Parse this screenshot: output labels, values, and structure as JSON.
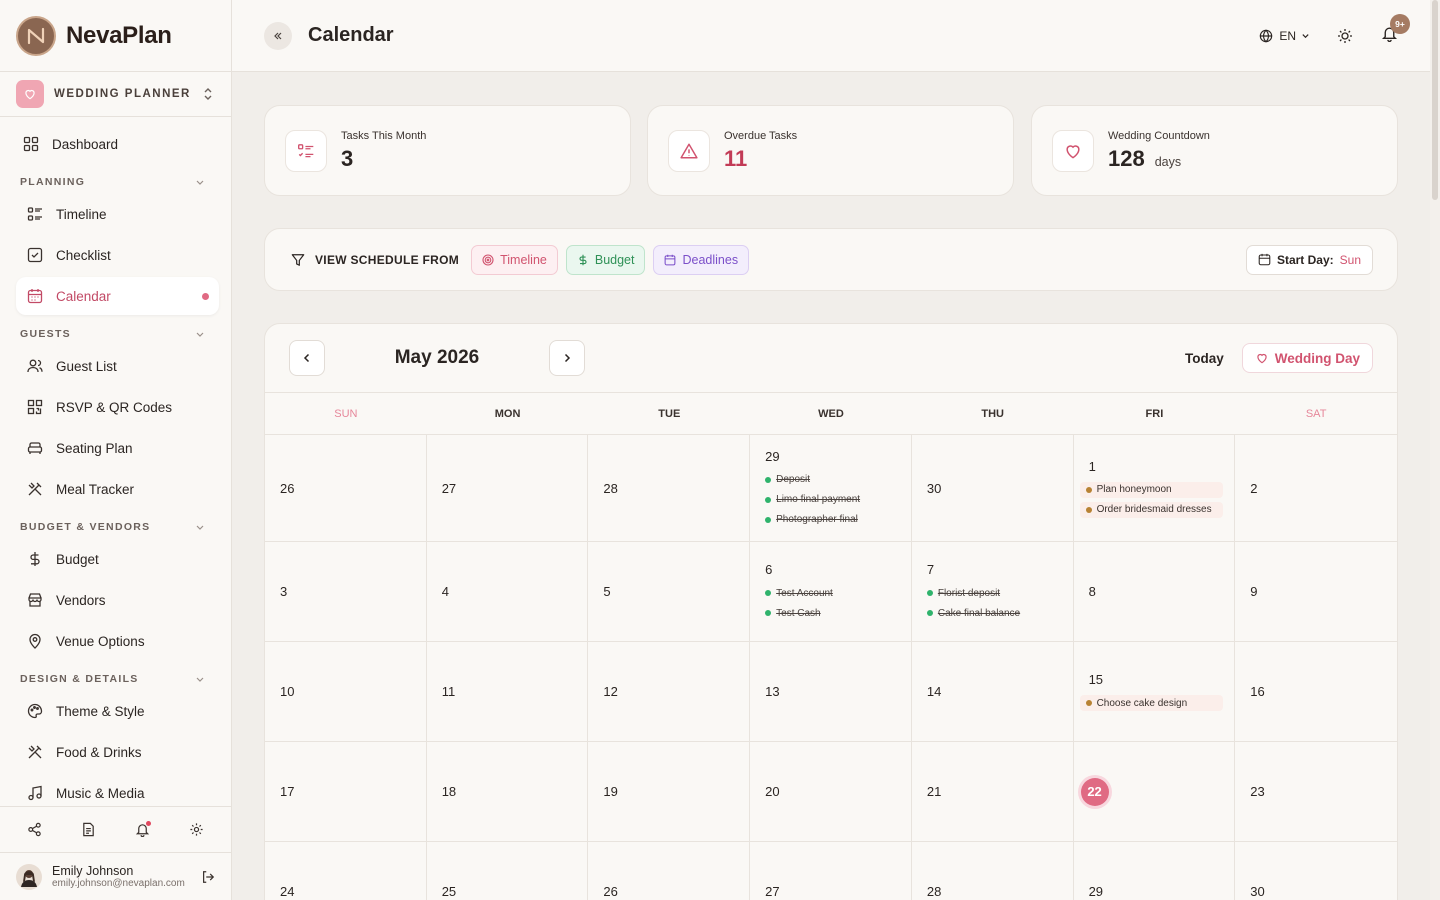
{
  "app": {
    "name": "NevaPlan"
  },
  "planner": {
    "label": "WEDDING PLANNER"
  },
  "nav": {
    "dashboard": "Dashboard",
    "sections": [
      {
        "title": "PLANNING",
        "items": [
          "Timeline",
          "Checklist",
          "Calendar"
        ]
      },
      {
        "title": "GUESTS",
        "items": [
          "Guest List",
          "RSVP & QR Codes",
          "Seating Plan",
          "Meal Tracker"
        ]
      },
      {
        "title": "BUDGET & VENDORS",
        "items": [
          "Budget",
          "Vendors",
          "Venue Options"
        ]
      },
      {
        "title": "DESIGN & DETAILS",
        "items": [
          "Theme & Style",
          "Food & Drinks",
          "Music & Media"
        ]
      }
    ],
    "active": "Calendar"
  },
  "user": {
    "name": "Emily Johnson",
    "email": "emily.johnson@nevaplan.com"
  },
  "header": {
    "title": "Calendar",
    "lang": "EN",
    "notifications": "9+"
  },
  "stats": [
    {
      "label": "Tasks This Month",
      "value": "3"
    },
    {
      "label": "Overdue Tasks",
      "value": "11"
    },
    {
      "label": "Wedding Countdown",
      "value": "128",
      "unit": "days"
    }
  ],
  "filter": {
    "title": "VIEW SCHEDULE FROM",
    "chips": [
      "Timeline",
      "Budget",
      "Deadlines"
    ],
    "start_day_label": "Start Day:",
    "start_day_value": "Sun"
  },
  "calendar": {
    "month": "May 2026",
    "today_label": "Today",
    "wedding_label": "Wedding Day",
    "weekdays": [
      "SUN",
      "MON",
      "TUE",
      "WED",
      "THU",
      "FRI",
      "SAT"
    ],
    "weeks": [
      [
        {
          "day": "26",
          "events": []
        },
        {
          "day": "27",
          "events": []
        },
        {
          "day": "28",
          "events": []
        },
        {
          "day": "29",
          "events": [
            {
              "text": "Deposit",
              "done": true
            },
            {
              "text": "Limo final payment",
              "done": true
            },
            {
              "text": "Photographer final",
              "done": true
            }
          ]
        },
        {
          "day": "30",
          "events": []
        },
        {
          "day": "1",
          "events": [
            {
              "text": "Plan honeymoon",
              "done": false
            },
            {
              "text": "Order bridesmaid dresses",
              "done": false
            }
          ]
        },
        {
          "day": "2",
          "events": []
        }
      ],
      [
        {
          "day": "3",
          "events": []
        },
        {
          "day": "4",
          "events": []
        },
        {
          "day": "5",
          "events": []
        },
        {
          "day": "6",
          "events": [
            {
              "text": "Test Account",
              "done": true
            },
            {
              "text": "Test Cash",
              "done": true
            }
          ]
        },
        {
          "day": "7",
          "events": [
            {
              "text": "Florist deposit",
              "done": true
            },
            {
              "text": "Cake final balance",
              "done": true
            }
          ]
        },
        {
          "day": "8",
          "events": []
        },
        {
          "day": "9",
          "events": []
        }
      ],
      [
        {
          "day": "10",
          "events": []
        },
        {
          "day": "11",
          "events": []
        },
        {
          "day": "12",
          "events": []
        },
        {
          "day": "13",
          "events": []
        },
        {
          "day": "14",
          "events": []
        },
        {
          "day": "15",
          "events": [
            {
              "text": "Choose cake design",
              "done": false
            }
          ]
        },
        {
          "day": "16",
          "events": []
        }
      ],
      [
        {
          "day": "17",
          "events": []
        },
        {
          "day": "18",
          "events": []
        },
        {
          "day": "19",
          "events": []
        },
        {
          "day": "20",
          "events": []
        },
        {
          "day": "21",
          "events": []
        },
        {
          "day": "22",
          "events": [],
          "today": true
        },
        {
          "day": "23",
          "events": []
        }
      ],
      [
        {
          "day": "24",
          "events": []
        },
        {
          "day": "25",
          "events": []
        },
        {
          "day": "26",
          "events": []
        },
        {
          "day": "27",
          "events": []
        },
        {
          "day": "28",
          "events": []
        },
        {
          "day": "29",
          "events": []
        },
        {
          "day": "30",
          "events": []
        }
      ]
    ]
  },
  "colors": {
    "accent": "#e06a83",
    "brand": "#8a6651",
    "done": "#2fb36c",
    "pending": "#b88234"
  }
}
